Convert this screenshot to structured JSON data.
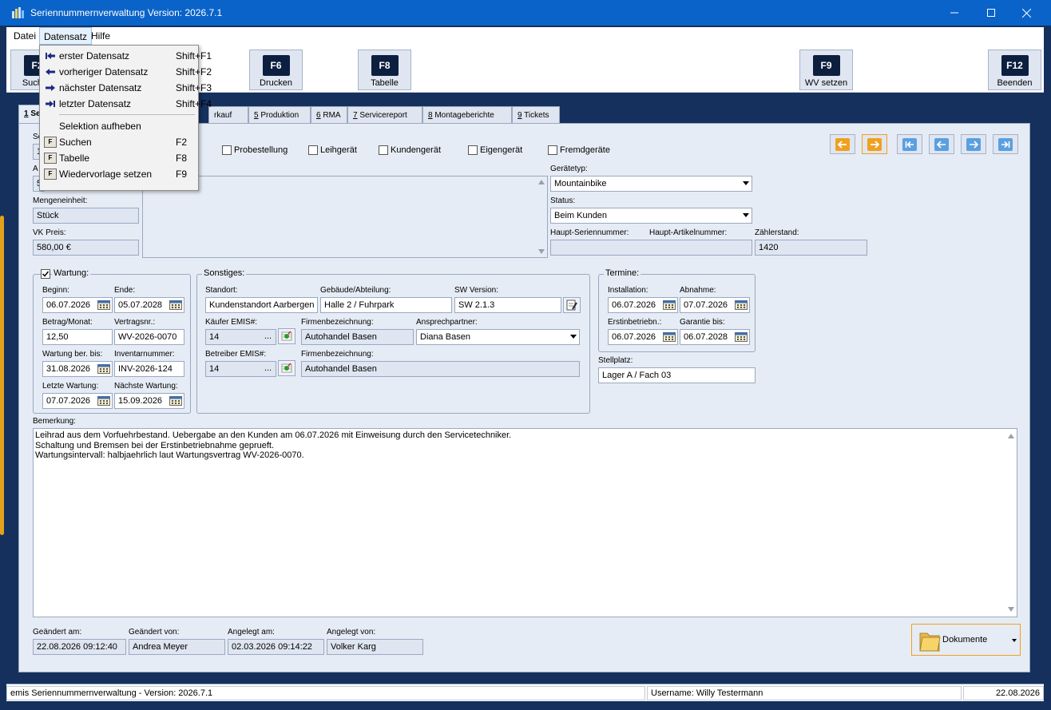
{
  "window": {
    "title": "Seriennummernverwaltung Version: 2026.7.1"
  },
  "menu": {
    "datei": "Datei",
    "datensatz": "Datensatz",
    "hilfe": "Hilfe"
  },
  "toolbar": {
    "buttons": [
      {
        "key": "F2",
        "label": "Suchen"
      },
      {
        "key": "F6",
        "label": "Drucken"
      },
      {
        "key": "F8",
        "label": "Tabelle"
      },
      {
        "key": "F9",
        "label": "WV setzen"
      },
      {
        "key": "F12",
        "label": "Beenden"
      }
    ]
  },
  "dropdown": {
    "items": [
      {
        "label": "erster Datensatz",
        "shortcut": "Shift+F1"
      },
      {
        "label": "vorheriger Datensatz",
        "shortcut": "Shift+F2"
      },
      {
        "label": "nächster Datensatz",
        "shortcut": "Shift+F3"
      },
      {
        "label": "letzter Datensatz",
        "shortcut": "Shift+F4"
      },
      {
        "label": "Selektion aufheben",
        "shortcut": ""
      },
      {
        "label": "Suchen",
        "shortcut": "F2"
      },
      {
        "label": "Tabelle",
        "shortcut": "F8"
      },
      {
        "label": "Wiedervorlage setzen",
        "shortcut": "F9"
      }
    ]
  },
  "tabs": [
    {
      "num": "1",
      "label": "Se"
    },
    {
      "num": "",
      "label": "rkauf"
    },
    {
      "num": "5",
      "label": "Produktion"
    },
    {
      "num": "6",
      "label": "RMA"
    },
    {
      "num": "7",
      "label": "Servicereport"
    },
    {
      "num": "8",
      "label": "Montageberichte"
    },
    {
      "num": "9",
      "label": "Tickets"
    }
  ],
  "checkboxes": [
    "Probestellung",
    "Leihgerät",
    "Kundengerät",
    "Eigengerät",
    "Fremdgeräte"
  ],
  "left": {
    "se_label": "Se",
    "se_value": "1",
    "a_label": "A",
    "a_value": "5",
    "mengeneinheit_label": "Mengeneinheit:",
    "mengeneinheit": "Stück",
    "vk_label": "VK Preis:",
    "vk": "580,00 €"
  },
  "right": {
    "geraetetyp_label": "Gerätetyp:",
    "geraetetyp": "Mountainbike",
    "status_label": "Status:",
    "status": "Beim Kunden",
    "haupt_sn_label": "Haupt-Seriennummer:",
    "haupt_art_label": "Haupt-Artikelnummer:",
    "zaehler_label": "Zählerstand:",
    "haupt_sn": "",
    "zaehler": "1420"
  },
  "wartung": {
    "title": "Wartung:",
    "checked": true,
    "beginn_label": "Beginn:",
    "beginn": "06.07.2026",
    "ende_label": "Ende:",
    "ende": "05.07.2028",
    "betrag_label": "Betrag/Monat:",
    "betrag": "12,50",
    "vertrag_label": "Vertragsnr.:",
    "vertrag": "WV-2026-0070",
    "berbis_label": "Wartung ber. bis:",
    "berbis": "31.08.2026",
    "inventar_label": "Inventarnummer:",
    "inventar": "INV-2026-124",
    "letzte_label": "Letzte Wartung:",
    "letzte": "07.07.2026",
    "naechste_label": "Nächste Wartung:",
    "naechste": "15.09.2026"
  },
  "sonstiges": {
    "title": "Sonstiges:",
    "standort_label": "Standort:",
    "standort": "Kundenstandort Aarbergen",
    "gebaeude_label": "Gebäude/Abteilung:",
    "gebaeude": "Halle 2 / Fuhrpark",
    "sw_label": "SW Version:",
    "sw": "SW 2.1.3",
    "kaeufer_label": "Käufer EMIS#:",
    "kaeufer": "14",
    "firma1_label": "Firmenbezeichnung:",
    "firma1": "Autohandel Basen",
    "ansprech_label": "Ansprechpartner:",
    "ansprech": "Diana Basen",
    "betreiber_label": "Betreiber EMIS#:",
    "betreiber": "14",
    "firma2_label": "Firmenbezeichnung:",
    "firma2": "Autohandel Basen",
    "dots": "..."
  },
  "termine": {
    "title": "Termine:",
    "install_label": "Installation:",
    "install": "06.07.2026",
    "abnahme_label": "Abnahme:",
    "abnahme": "07.07.2026",
    "erst_label": "Erstinbetriebn.:",
    "erst": "06.07.2026",
    "garantie_label": "Garantie bis:",
    "garantie": "06.07.2028",
    "stellplatz_label": "Stellplatz:",
    "stellplatz": "Lager A / Fach 03"
  },
  "bemerkung": {
    "label": "Bemerkung:",
    "lines": [
      "Leihrad aus dem Vorfuehrbestand. Uebergabe an den Kunden am 06.07.2026 mit Einweisung durch den Servicetechniker.",
      "Schaltung und Bremsen bei der Erstinbetriebnahme geprueft.",
      "Wartungsintervall: halbjaehrlich laut Wartungsvertrag WV-2026-0070."
    ]
  },
  "audit": {
    "geaendert_am_label": "Geändert am:",
    "geaendert_am": "22.08.2026 09:12:40",
    "geaendert_von_label": "Geändert von:",
    "geaendert_von": "Andrea Meyer",
    "angelegt_am_label": "Angelegt am:",
    "angelegt_am": "02.03.2026 09:14:22",
    "angelegt_von_label": "Angelegt von:",
    "angelegt_von": "Volker Karg"
  },
  "dokumente": {
    "label": "Dokumente"
  },
  "statusbar": {
    "app": "emis Seriennummernverwaltung - Version: 2026.7.1",
    "user": "Username: Willy Testermann",
    "date": "22.08.2026"
  },
  "colors": {
    "accent": "#f0a020",
    "titlebar": "#0a63c9",
    "panel": "#e6ecf5",
    "nav_blue": "#5aa0e0"
  }
}
